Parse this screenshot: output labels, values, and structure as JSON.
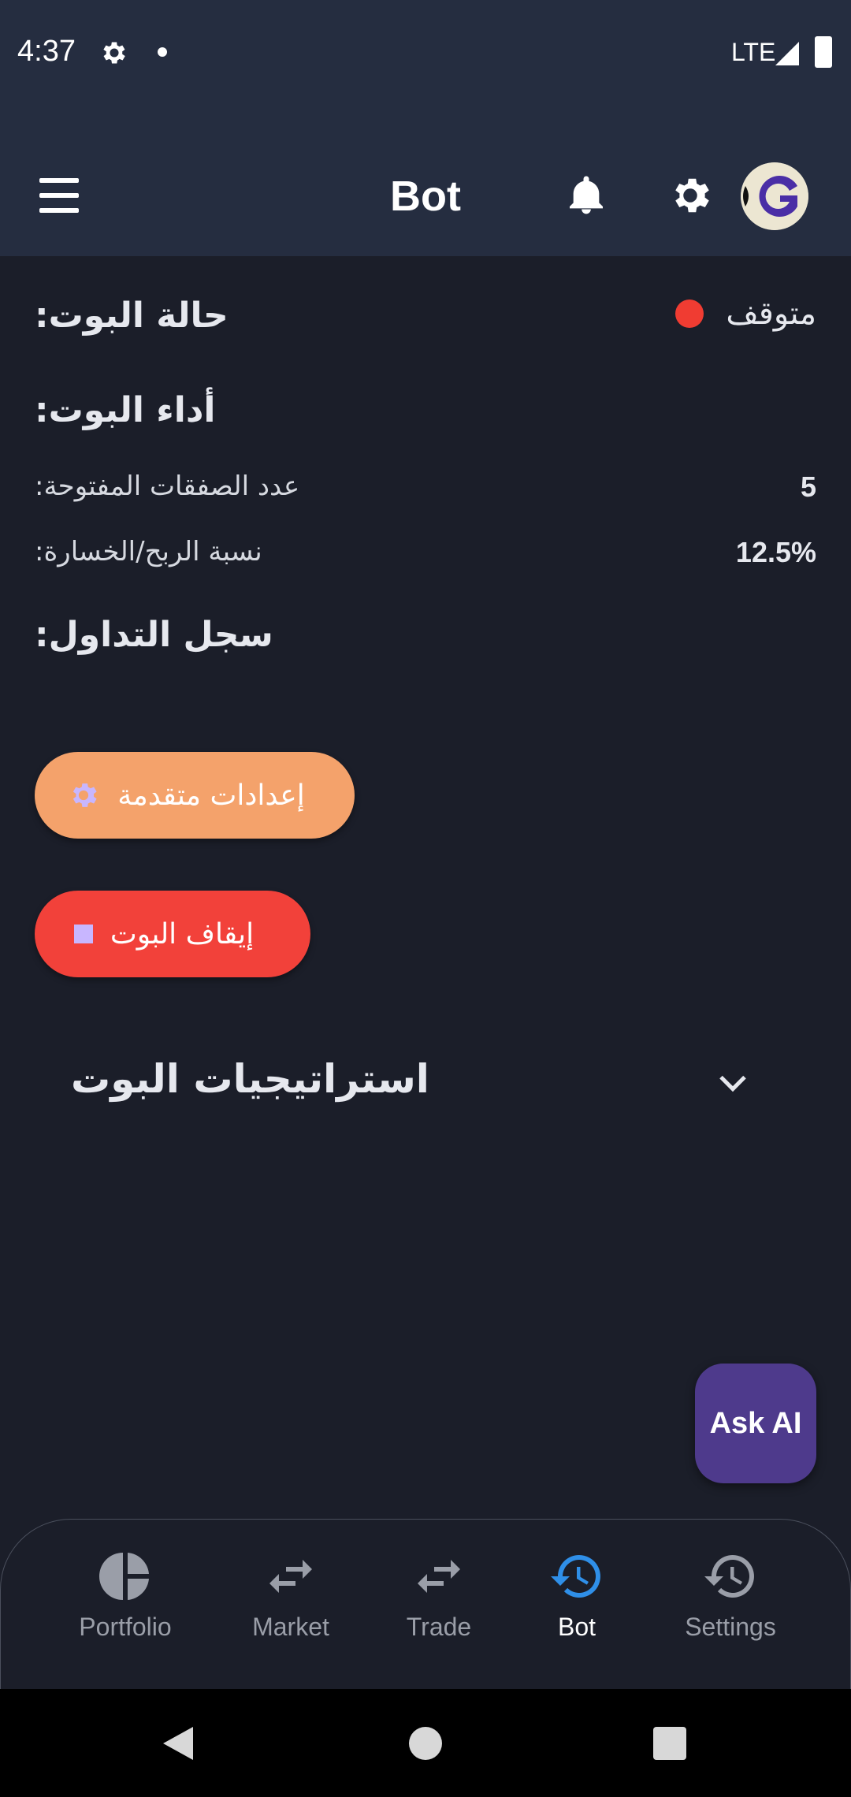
{
  "status_bar": {
    "time": "4:37",
    "network": "LTE"
  },
  "app_bar": {
    "title": "Bot"
  },
  "bot_status": {
    "label": "حالة البوت:",
    "value": "متوقف",
    "indicator_color": "#f03c32"
  },
  "performance": {
    "title": "أداء البوت:",
    "metrics": [
      {
        "label": "عدد الصفقات المفتوحة:",
        "value": "5"
      },
      {
        "label": "نسبة الربح/الخسارة:",
        "value": "12.5%"
      }
    ]
  },
  "trade_log": {
    "title": "سجل التداول:"
  },
  "buttons": {
    "advanced_settings": "إعدادات متقدمة",
    "stop_bot": "إيقاف البوت"
  },
  "strategies": {
    "title": "استراتيجيات البوت"
  },
  "fab": {
    "label": "Ask AI"
  },
  "bottom_nav": {
    "items": [
      {
        "label": "Portfolio",
        "icon": "pie-chart-icon"
      },
      {
        "label": "Market",
        "icon": "swap-arrows-icon"
      },
      {
        "label": "Trade",
        "icon": "swap-arrows-icon"
      },
      {
        "label": "Bot",
        "icon": "history-icon",
        "active": true
      },
      {
        "label": "Settings",
        "icon": "history-icon"
      }
    ]
  },
  "colors": {
    "background": "#1b1e29",
    "app_bar": "#252d40",
    "advanced_button": "#f4a26b",
    "stop_button": "#f2413a",
    "fab": "#4e3a8c",
    "active_nav": "#2f8fe8"
  }
}
